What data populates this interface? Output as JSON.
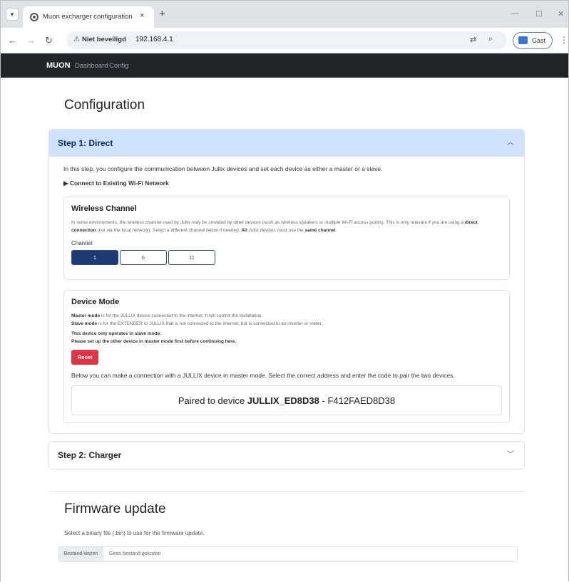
{
  "browser": {
    "tab_title": "Muon excharger configuration",
    "tab_close": "×",
    "new_tab": "+",
    "security_label": "Niet beveiligd",
    "url": "192.168.4.1",
    "profile_label": "Gast"
  },
  "navbar": {
    "brand": "MUON",
    "links": [
      "Dashboard",
      "Config"
    ]
  },
  "page_title": "Configuration",
  "step1": {
    "title": "Step 1: Direct",
    "intro": "In this step, you configure the communication between Jullix devices and set each device as either a master or a slave.",
    "wifi_summary": "Connect to Existing Wi-Fi Network",
    "wireless": {
      "title": "Wireless Channel",
      "desc_1": "In some environments, the wireless channel used by Jullix may be crowded by other devices (such as wireless speakers or multiple Wi-Fi access points). This is only relevant if you are using a ",
      "desc_bold_1": "direct connection",
      "desc_2": " (not via the local network). Select a different channel below if needed. ",
      "desc_bold_2": "All",
      "desc_3": " Jullix devices must use the ",
      "desc_bold_3": "same channel",
      "desc_4": ".",
      "channel_label": "Channel",
      "channels": [
        "1",
        "6",
        "11"
      ],
      "selected_channel": "1"
    },
    "device_mode": {
      "title": "Device Mode",
      "master_bold": "Master mode",
      "master_text": " is for the JULLIX device connected to the internet. It will control the installation.",
      "slave_bold": "Slave mode",
      "slave_text": " is for the EXTENDER or JULLIX that is not connected to the internet, but is connected to an inverter or meter.",
      "notice_1": "This device only operates in slave mode.",
      "notice_2": "Please set up the other device in master mode first before continuing here.",
      "reset_label": "Reset"
    },
    "pairing_note": "Below you can make a connection with a JULLIX device in master mode. Select the correct address and enter the code to pair the two devices.",
    "paired_prefix": "Paired to device ",
    "paired_device": "JULLIX_ED8D38",
    "paired_suffix": " - F412FAED8D38"
  },
  "step2": {
    "title": "Step 2: Charger"
  },
  "firmware": {
    "title": "Firmware update",
    "desc": "Select a binary file (.bin) to use for the firmware update.",
    "file_button": "Bestand kiezen",
    "file_none": "Geen bestand gekozen"
  }
}
